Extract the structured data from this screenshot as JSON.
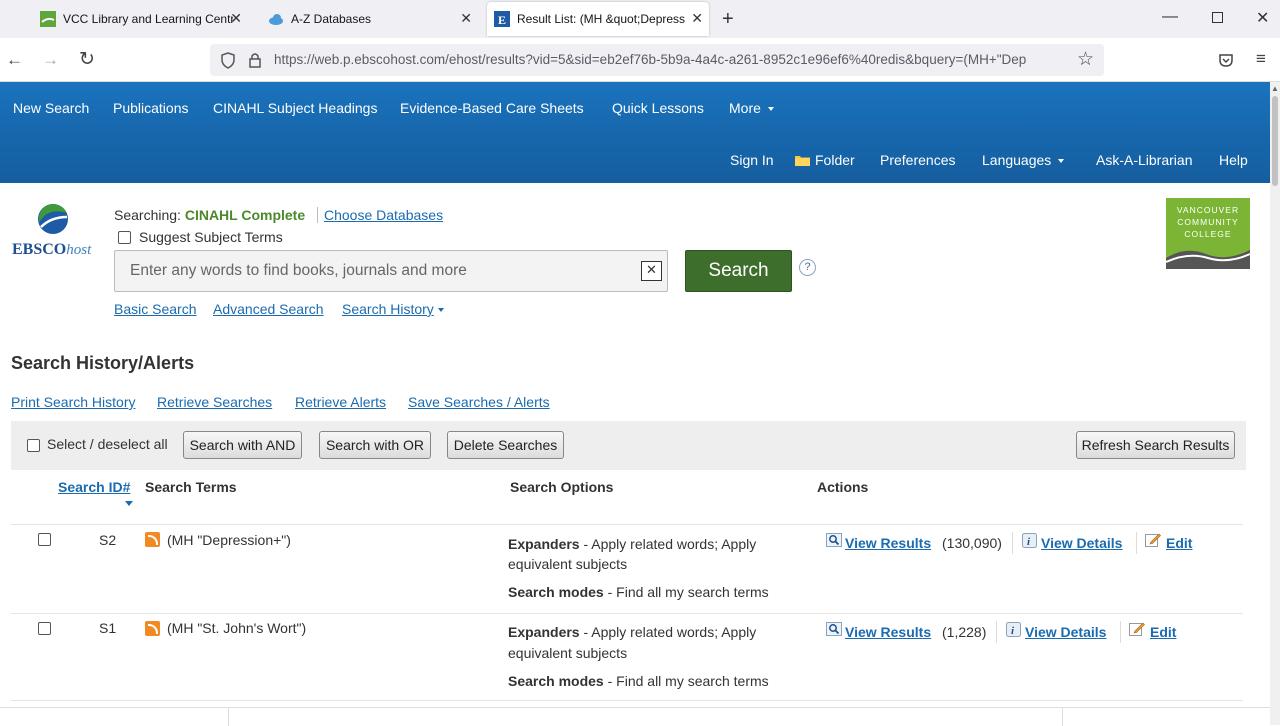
{
  "browser": {
    "tabs": [
      {
        "title": "VCC Library and Learning Centr"
      },
      {
        "title": "A-Z Databases"
      },
      {
        "title": "Result List: (MH &quot;Depress"
      }
    ],
    "new_tab_icon": "plus-icon",
    "url": "https://web.p.ebscohost.com/ehost/results?vid=5&sid=eb2ef76b-5b9a-4a4c-a261-8952c1e96ef6%40redis&bquery=(MH+\"Dep"
  },
  "topnav": {
    "primary": [
      "New Search",
      "Publications",
      "CINAHL Subject Headings",
      "Evidence-Based Care Sheets",
      "Quick Lessons",
      "More"
    ],
    "secondary": {
      "sign_in": "Sign In",
      "folder": "Folder",
      "preferences": "Preferences",
      "languages": "Languages",
      "ask": "Ask-A-Librarian",
      "help": "Help"
    }
  },
  "logo": {
    "text_main": "EBSCO",
    "text_sub": "host"
  },
  "vcc_logo": {
    "line1": "VANCOUVER",
    "line2": "COMMUNITY",
    "line3": "COLLEGE"
  },
  "search": {
    "searching_label": "Searching:",
    "database": "CINAHL Complete",
    "choose_databases": "Choose Databases",
    "suggest_terms": "Suggest Subject Terms",
    "placeholder": "Enter any words to find books, journals and more",
    "clear_label": "✕",
    "search_button": "Search",
    "help_label": "?",
    "links": {
      "basic": "Basic Search",
      "advanced": "Advanced Search",
      "history": "Search History"
    }
  },
  "history": {
    "title": "Search History/Alerts",
    "links": [
      "Print Search History",
      "Retrieve Searches",
      "Retrieve Alerts",
      "Save Searches / Alerts"
    ],
    "toolbar": {
      "select_all": "Select / deselect all",
      "search_and": "Search with AND",
      "search_or": "Search with OR",
      "delete": "Delete Searches",
      "refresh": "Refresh Search Results"
    },
    "columns": {
      "id": "Search ID#",
      "terms": "Search Terms",
      "options": "Search Options",
      "actions": "Actions"
    },
    "rows": [
      {
        "id": "S2",
        "terms": "(MH \"Depression+\")",
        "expanders_label": "Expanders",
        "expanders_text": " - Apply related words; Apply",
        "expanders_text2": "equivalent subjects",
        "modes_label": "Search modes",
        "modes_text": " - Find all my search terms",
        "view_results": "View Results",
        "count": "(130,090)",
        "view_details": "View Details",
        "edit": "Edit"
      },
      {
        "id": "S1",
        "terms": "(MH \"St. John's Wort\")",
        "expanders_label": "Expanders",
        "expanders_text": " - Apply related words; Apply",
        "expanders_text2": "equivalent subjects",
        "modes_label": "Search modes",
        "modes_text": " - Find all my search terms",
        "view_results": "View Results",
        "count": "(1,228)",
        "view_details": "View Details",
        "edit": "Edit"
      }
    ]
  }
}
